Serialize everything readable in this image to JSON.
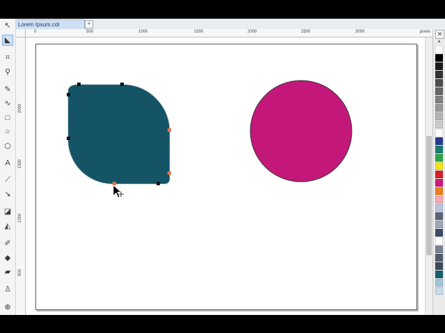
{
  "document_tab": {
    "label": "Lorem Ipsum.cdr",
    "add_label": "+"
  },
  "ruler": {
    "units": "pixels",
    "top_labels": [
      "0",
      "500",
      "1000",
      "1500",
      "2000",
      "2500",
      "3000"
    ],
    "left_labels": [
      "2000",
      "1500",
      "1000",
      "500"
    ]
  },
  "tools": [
    "pick-tool",
    "shape-tool",
    "crop-tool",
    "zoom-tool",
    "freehand-tool",
    "artistic-media-tool",
    "rectangle-tool",
    "ellipse-tool",
    "polygon-tool",
    "text-tool",
    "parallel-dimension-tool",
    "connector-tool",
    "drop-shadow-tool",
    "transparency-tool",
    "color-eyedropper-tool",
    "interactive-fill-tool",
    "smart-fill-tool",
    "outline-pen-tool",
    "pan-tool"
  ],
  "shapes": {
    "leaf_shape": {
      "fill": "#155466",
      "selected": true
    },
    "circle": {
      "fill": "#c4177a",
      "stroke": "#3a3a3a"
    }
  },
  "palette": {
    "colors": [
      "#ffffff",
      "#000000",
      "#1a1a1a",
      "#333333",
      "#4d4d4d",
      "#666666",
      "#808080",
      "#999999",
      "#b3b3b3",
      "#cccccc",
      "#ffffff",
      "#263d8f",
      "#1a7a6e",
      "#2ea44a",
      "#f0e417",
      "#d81e2a",
      "#cc1a7a",
      "#ef7d1a",
      "#f5a9b0",
      "#b9c5de",
      "#5a6378",
      "#9fa6b4",
      "#3c4b63",
      "#ffffff",
      "#7a8192",
      "#505a6c",
      "#3d4a5c",
      "#195e6e",
      "#9fc6d8",
      "#c7dbe8"
    ]
  }
}
